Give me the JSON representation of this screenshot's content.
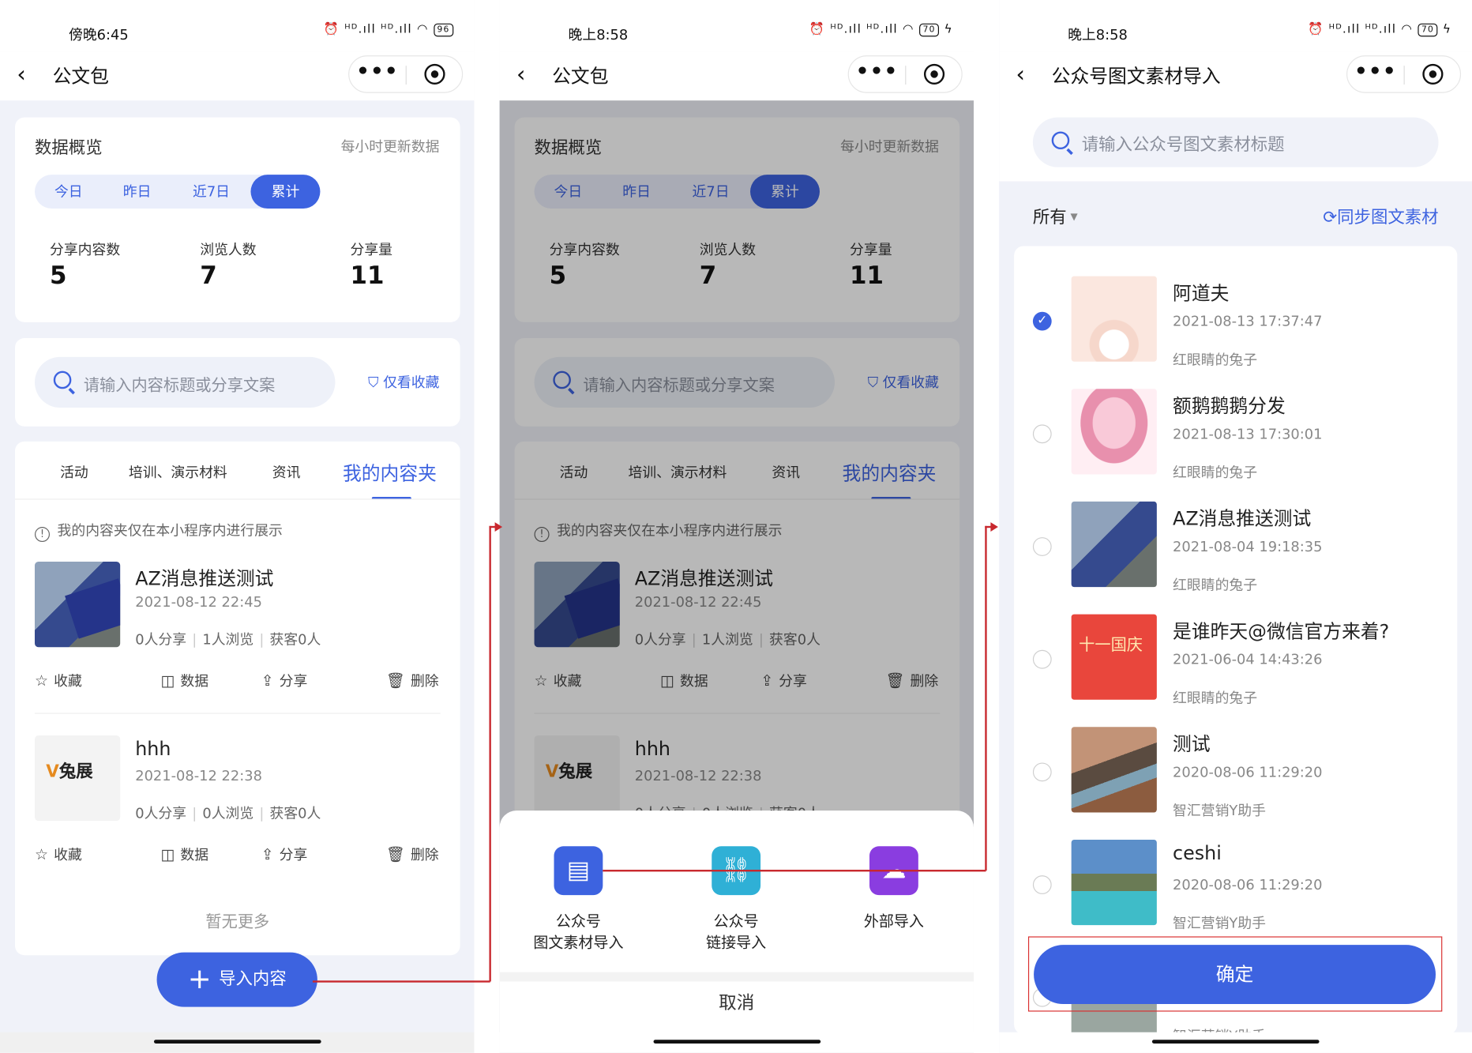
{
  "screen1": {
    "status": {
      "time": "傍晚6:45",
      "icons": "⏰ ᴴᴰ.ıll ᴴᴰ.ıll",
      "battery": "96"
    },
    "nav": {
      "back": "‹",
      "title": "公文包",
      "more": "•••",
      "target": "◎"
    },
    "stats": {
      "heading": "数据概览",
      "note": "每小时更新数据",
      "periods": [
        "今日",
        "昨日",
        "近7日",
        "累计"
      ],
      "active_period": "累计",
      "items": [
        {
          "label": "分享内容数",
          "value": "5"
        },
        {
          "label": "浏览人数",
          "value": "7"
        },
        {
          "label": "分享量",
          "value": "11"
        }
      ]
    },
    "search": {
      "placeholder": "请输入内容标题或分享文案",
      "favorites_only": "仅看收藏"
    },
    "tabs": [
      "活动",
      "培训、演示材料",
      "资讯",
      "我的内容夹"
    ],
    "active_tab": "我的内容夹",
    "info_note": "我的内容夹仅在本小程序内进行展示",
    "items": [
      {
        "title": "AZ消息推送测试",
        "date": "2021-08-12 22:45",
        "shares": "0人分享",
        "views": "1人浏览",
        "customers": "获客0人"
      },
      {
        "title": "hhh",
        "date": "2021-08-12 22:38",
        "shares": "0人分享",
        "views": "0人浏览",
        "customers": "获客0人",
        "logo_text": "兔展"
      }
    ],
    "actions": {
      "favorite": "收藏",
      "data": "数据",
      "share": "分享",
      "delete": "删除"
    },
    "no_more": "暂无更多",
    "import_button": "导入内容"
  },
  "screen2": {
    "status": {
      "time": "晚上8:58",
      "icons": "⏰ ᴴᴰ.ıll ᴴᴰ.ıll",
      "battery": "70"
    },
    "sheet": {
      "options": [
        {
          "label_line1": "公众号",
          "label_line2": "图文素材导入",
          "color": "#3d63e0"
        },
        {
          "label_line1": "公众号",
          "label_line2": "链接导入",
          "color": "#2fb0d6"
        },
        {
          "label_line1": "外部导入",
          "label_line2": "",
          "color": "#8a3de0"
        }
      ],
      "cancel": "取消"
    }
  },
  "screen3": {
    "status": {
      "time": "晚上8:58",
      "icons": "⏰ ᴴᴰ.ıll ᴴᴰ.ıll",
      "battery": "70"
    },
    "nav": {
      "title": "公众号图文素材导入"
    },
    "search_placeholder": "请输入公众号图文素材标题",
    "filter": "所有",
    "sync": "同步图文素材",
    "materials": [
      {
        "title": "阿道夫",
        "date": "2021-08-13 17:37:47",
        "author": "红眼睛的兔子",
        "selected": true
      },
      {
        "title": "额鹅鹅鹅分发",
        "date": "2021-08-13 17:30:01",
        "author": "红眼睛的兔子",
        "selected": false
      },
      {
        "title": "AZ消息推送测试",
        "date": "2021-08-04 19:18:35",
        "author": "红眼睛的兔子",
        "selected": false
      },
      {
        "title": "是谁昨天@微信官方来着?",
        "date": "2021-06-04 14:43:26",
        "author": "红眼睛的兔子",
        "selected": false,
        "thumb_text": "十一国庆"
      },
      {
        "title": "测试",
        "date": "2020-08-06 11:29:20",
        "author": "智汇营销Y助手",
        "selected": false
      },
      {
        "title": "ceshi",
        "date": "2020-08-06 11:29:20",
        "author": "智汇营销Y助手",
        "selected": false
      },
      {
        "title": "",
        "date": "",
        "author": "智汇营销Y助手",
        "selected": false
      }
    ],
    "confirm": "确定"
  },
  "colors": {
    "accent": "#3d63e0",
    "annotation": "#c8282e",
    "background": "#f0f2f9"
  }
}
